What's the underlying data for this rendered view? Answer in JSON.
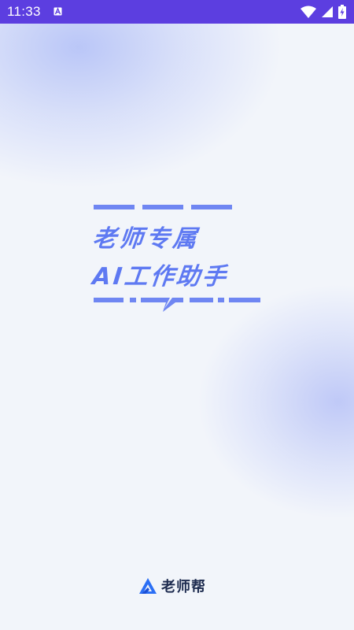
{
  "status_bar": {
    "time": "11:33",
    "background": "#5c3ee0",
    "icons": [
      "text-a-icon",
      "wifi-icon",
      "cellular-signal-icon",
      "battery-charging-icon"
    ]
  },
  "hero": {
    "line1": "老师专属",
    "line2": "AI工作助手",
    "accent_color": "#5e79f2"
  },
  "brand": {
    "name": "老师帮",
    "logo_icon": "triangle-a-logo-icon",
    "logo_color": "#2b6ff5"
  }
}
